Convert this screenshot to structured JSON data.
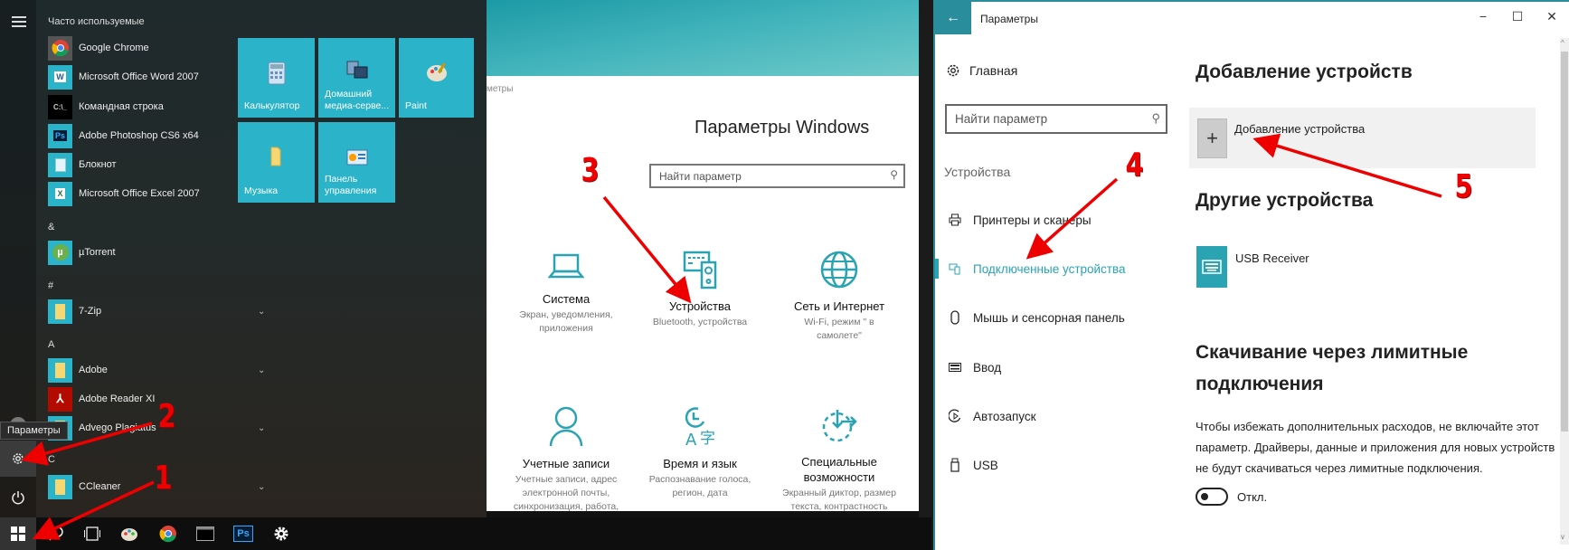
{
  "start_menu": {
    "section_frequent": "Часто используемые",
    "frequent_apps": [
      {
        "label": "Google Chrome",
        "icon": "chrome-icon"
      },
      {
        "label": "Microsoft Office Word 2007",
        "icon": "word-icon"
      },
      {
        "label": "Командная строка",
        "icon": "cmd-icon"
      },
      {
        "label": "Adobe Photoshop CS6 x64",
        "icon": "photoshop-icon"
      },
      {
        "label": "Блокнот",
        "icon": "notepad-icon"
      },
      {
        "label": "Microsoft Office Excel 2007",
        "icon": "excel-icon"
      }
    ],
    "groups": [
      {
        "letter": "&",
        "apps": [
          {
            "label": "µTorrent",
            "icon": "utorrent-icon",
            "expandable": false
          }
        ]
      },
      {
        "letter": "#",
        "apps": [
          {
            "label": "7-Zip",
            "icon": "folder-icon",
            "expandable": true
          }
        ]
      },
      {
        "letter": "A",
        "apps": [
          {
            "label": "Adobe",
            "icon": "folder-icon",
            "expandable": true
          },
          {
            "label": "Adobe Reader XI",
            "icon": "adobe-reader-icon",
            "expandable": false
          },
          {
            "label": "Advego Plagiatus",
            "icon": "folder-icon",
            "expandable": true
          }
        ]
      },
      {
        "letter": "C",
        "apps": [
          {
            "label": "CCleaner",
            "icon": "folder-icon",
            "expandable": true
          }
        ]
      }
    ],
    "tooltip": "Параметры",
    "tiles": [
      {
        "label": "Калькулятор",
        "icon": "calculator-icon"
      },
      {
        "label": "Домашний медиа-серве...",
        "icon": "media-server-icon"
      },
      {
        "label": "Paint",
        "icon": "paint-icon"
      },
      {
        "label": "Музыка",
        "icon": "folder-icon"
      },
      {
        "label": "Панель управления",
        "icon": "control-panel-icon"
      }
    ]
  },
  "taskbar": {
    "items": [
      "start-button",
      "search-button",
      "task-view-button",
      "paint-app",
      "chrome-app",
      "cmd-app",
      "photoshop-app",
      "settings-app"
    ],
    "ps_label": "Ps"
  },
  "windows_settings": {
    "breadcrumb": "метры",
    "title": "Параметры Windows",
    "search_placeholder": "Найти параметр",
    "categories": [
      {
        "title": "Система",
        "subtitle": "Экран, уведомления, приложения"
      },
      {
        "title": "Устройства",
        "subtitle": "Bluetooth, устройства"
      },
      {
        "title": "Сеть и Интернет",
        "subtitle": "Wi-Fi, режим \" в самолете\""
      },
      {
        "title": "Учетные записи",
        "subtitle": "Учетные записи, адрес электронной почты, синхронизация, работа,"
      },
      {
        "title": "Время и язык",
        "subtitle": "Распознавание голоса, регион, дата"
      },
      {
        "title": "Специальные возможности",
        "subtitle": "Экранный диктор, размер текста, контрастность"
      }
    ]
  },
  "devices_settings": {
    "window_title": "Параметры",
    "home_label": "Главная",
    "search_placeholder": "Найти параметр",
    "section": "Устройства",
    "nav": [
      {
        "label": "Принтеры и сканеры",
        "icon": "printer-icon",
        "active": false
      },
      {
        "label": "Подключенные устройства",
        "icon": "connected-devices-icon",
        "active": true
      },
      {
        "label": "Мышь и сенсорная панель",
        "icon": "mouse-icon",
        "active": false
      },
      {
        "label": "Ввод",
        "icon": "keyboard-icon",
        "active": false
      },
      {
        "label": "Автозапуск",
        "icon": "autoplay-icon",
        "active": false
      },
      {
        "label": "USB",
        "icon": "usb-icon",
        "active": false
      }
    ],
    "add_heading": "Добавление устройств",
    "add_button": "Добавление устройства",
    "other_heading": "Другие устройства",
    "device_name": "USB Receiver",
    "metered_heading": "Скачивание через лимитные подключения",
    "metered_desc": "Чтобы избежать дополнительных расходов, не включайте этот параметр. Драйверы, данные и приложения для новых устройств не будут скачиваться через лимитные подключения.",
    "toggle_state": "Откл.",
    "toggle_on": false
  },
  "annotations": [
    "1",
    "2",
    "3",
    "4",
    "5"
  ],
  "colors": {
    "accent": "#2aa3b3",
    "tile": "#2bb3c9",
    "annotation": "#e00000"
  }
}
